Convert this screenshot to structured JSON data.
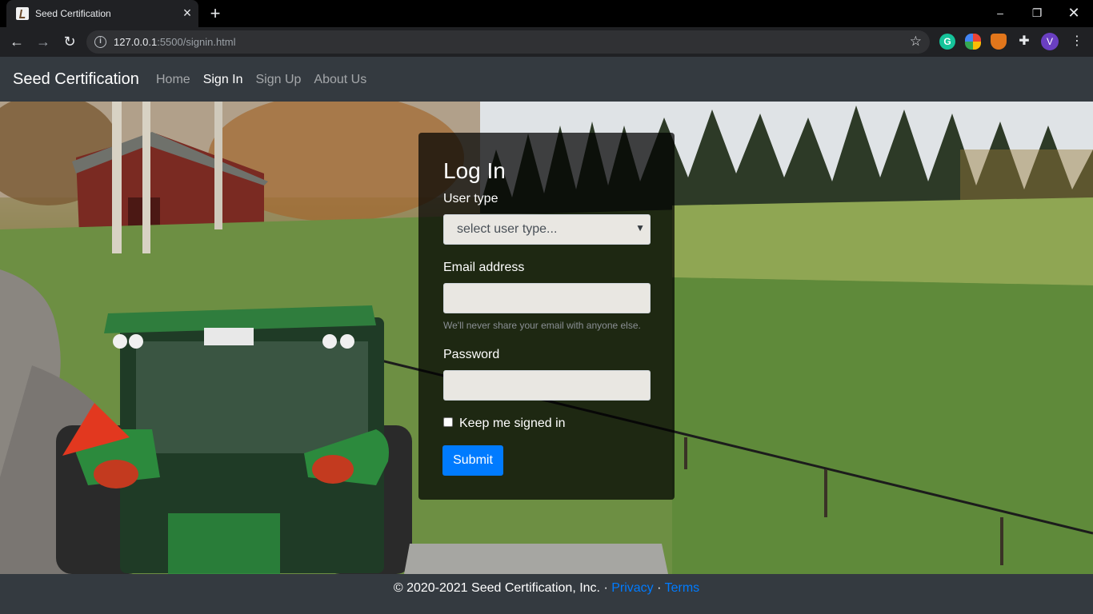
{
  "browser": {
    "tab_title": "Seed Certification",
    "new_tab_label": "+",
    "url_host": "127.0.0.1",
    "url_path": ":5500/signin.html",
    "profile_initial": "V",
    "extension_grammarly_letter": "G",
    "window_controls": [
      "minimize-icon",
      "restore-icon",
      "close-icon"
    ]
  },
  "navbar": {
    "brand": "Seed Certification",
    "links": [
      {
        "label": "Home",
        "active": false
      },
      {
        "label": "Sign In",
        "active": true
      },
      {
        "label": "Sign Up",
        "active": false
      },
      {
        "label": "About Us",
        "active": false
      }
    ]
  },
  "login": {
    "title": "Log In",
    "user_type_label": "User type",
    "user_type_selected": "select user type...",
    "email_label": "Email address",
    "email_value": "",
    "email_hint": "We'll never share your email with anyone else.",
    "password_label": "Password",
    "password_value": "",
    "remember_label": "Keep me signed in",
    "remember_checked": false,
    "submit_label": "Submit"
  },
  "footer": {
    "copyright": "© 2020-2021 Seed Certification, Inc. · ",
    "privacy": "Privacy",
    "separator": " · ",
    "terms": "Terms"
  },
  "colors": {
    "navbar_bg": "#343a40",
    "primary": "#007bff",
    "card_bg": "rgba(0,0,0,0.72)"
  }
}
